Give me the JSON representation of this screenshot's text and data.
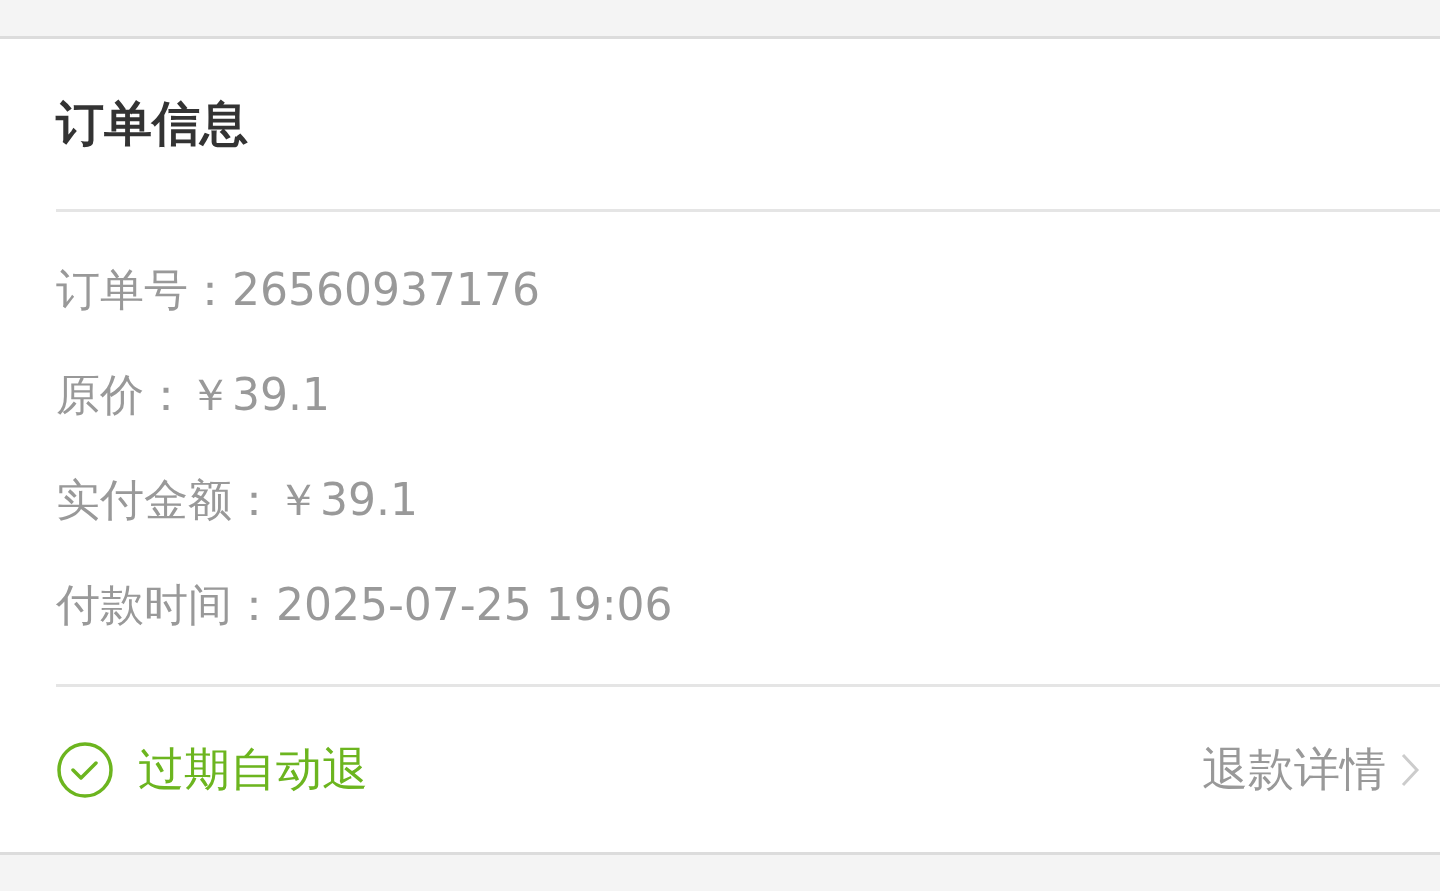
{
  "section": {
    "title": "订单信息"
  },
  "fields": [
    {
      "label": "订单号：",
      "value": "26560937176"
    },
    {
      "label": "原价：",
      "value": "￥39.1"
    },
    {
      "label": "实付金额：",
      "value": "￥39.1"
    },
    {
      "label": "付款时间：",
      "value": "2025-07-25 19:06"
    }
  ],
  "status": {
    "kind": "success",
    "text": "过期自动退"
  },
  "refund_link": {
    "label": "退款详情"
  }
}
